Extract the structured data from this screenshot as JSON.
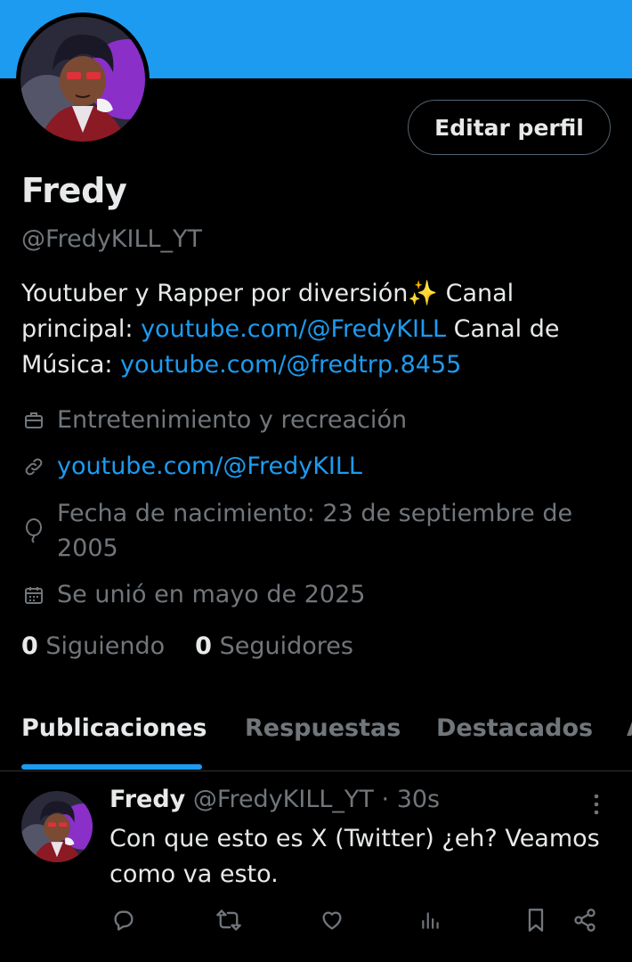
{
  "colors": {
    "banner": "#1d9bf0",
    "link": "#1d9bf0",
    "text": "#e7e9ea",
    "muted": "#71767b",
    "border": "#536471"
  },
  "profile": {
    "edit_button": "Editar perfil",
    "name": "Fredy",
    "handle": "@FredyKILL_YT",
    "bio": {
      "part1": "Youtuber y Rapper por diversión✨  Canal principal: ",
      "link1": "youtube.com/@FredyKILL",
      "part2": "  Canal de Música: ",
      "link2": "youtube.com/@fredtrp.8455"
    },
    "meta": {
      "category": {
        "icon": "briefcase-icon",
        "text": "Entretenimiento y recreación"
      },
      "website": {
        "icon": "link-icon",
        "text": "youtube.com/@FredyKILL"
      },
      "birthday": {
        "icon": "balloon-icon",
        "text": "Fecha de nacimiento: 23 de septiembre de 2005"
      },
      "joined": {
        "icon": "calendar-icon",
        "text": "Se unió en mayo de 2025"
      }
    },
    "following_count": "0",
    "following_label": "Siguiendo",
    "followers_count": "0",
    "followers_label": "Seguidores"
  },
  "tabs": [
    "Publicaciones",
    "Respuestas",
    "Destacados",
    "A"
  ],
  "active_tab": "Publicaciones",
  "post": {
    "author": "Fredy",
    "handle": "@FredyKILL_YT",
    "separator": "·",
    "time": "30s",
    "text": "Con que esto es X (Twitter) ¿eh? Veamos como va esto.",
    "actions": [
      "reply-icon",
      "repost-icon",
      "like-icon",
      "views-icon",
      "bookmark-icon",
      "share-icon"
    ]
  }
}
